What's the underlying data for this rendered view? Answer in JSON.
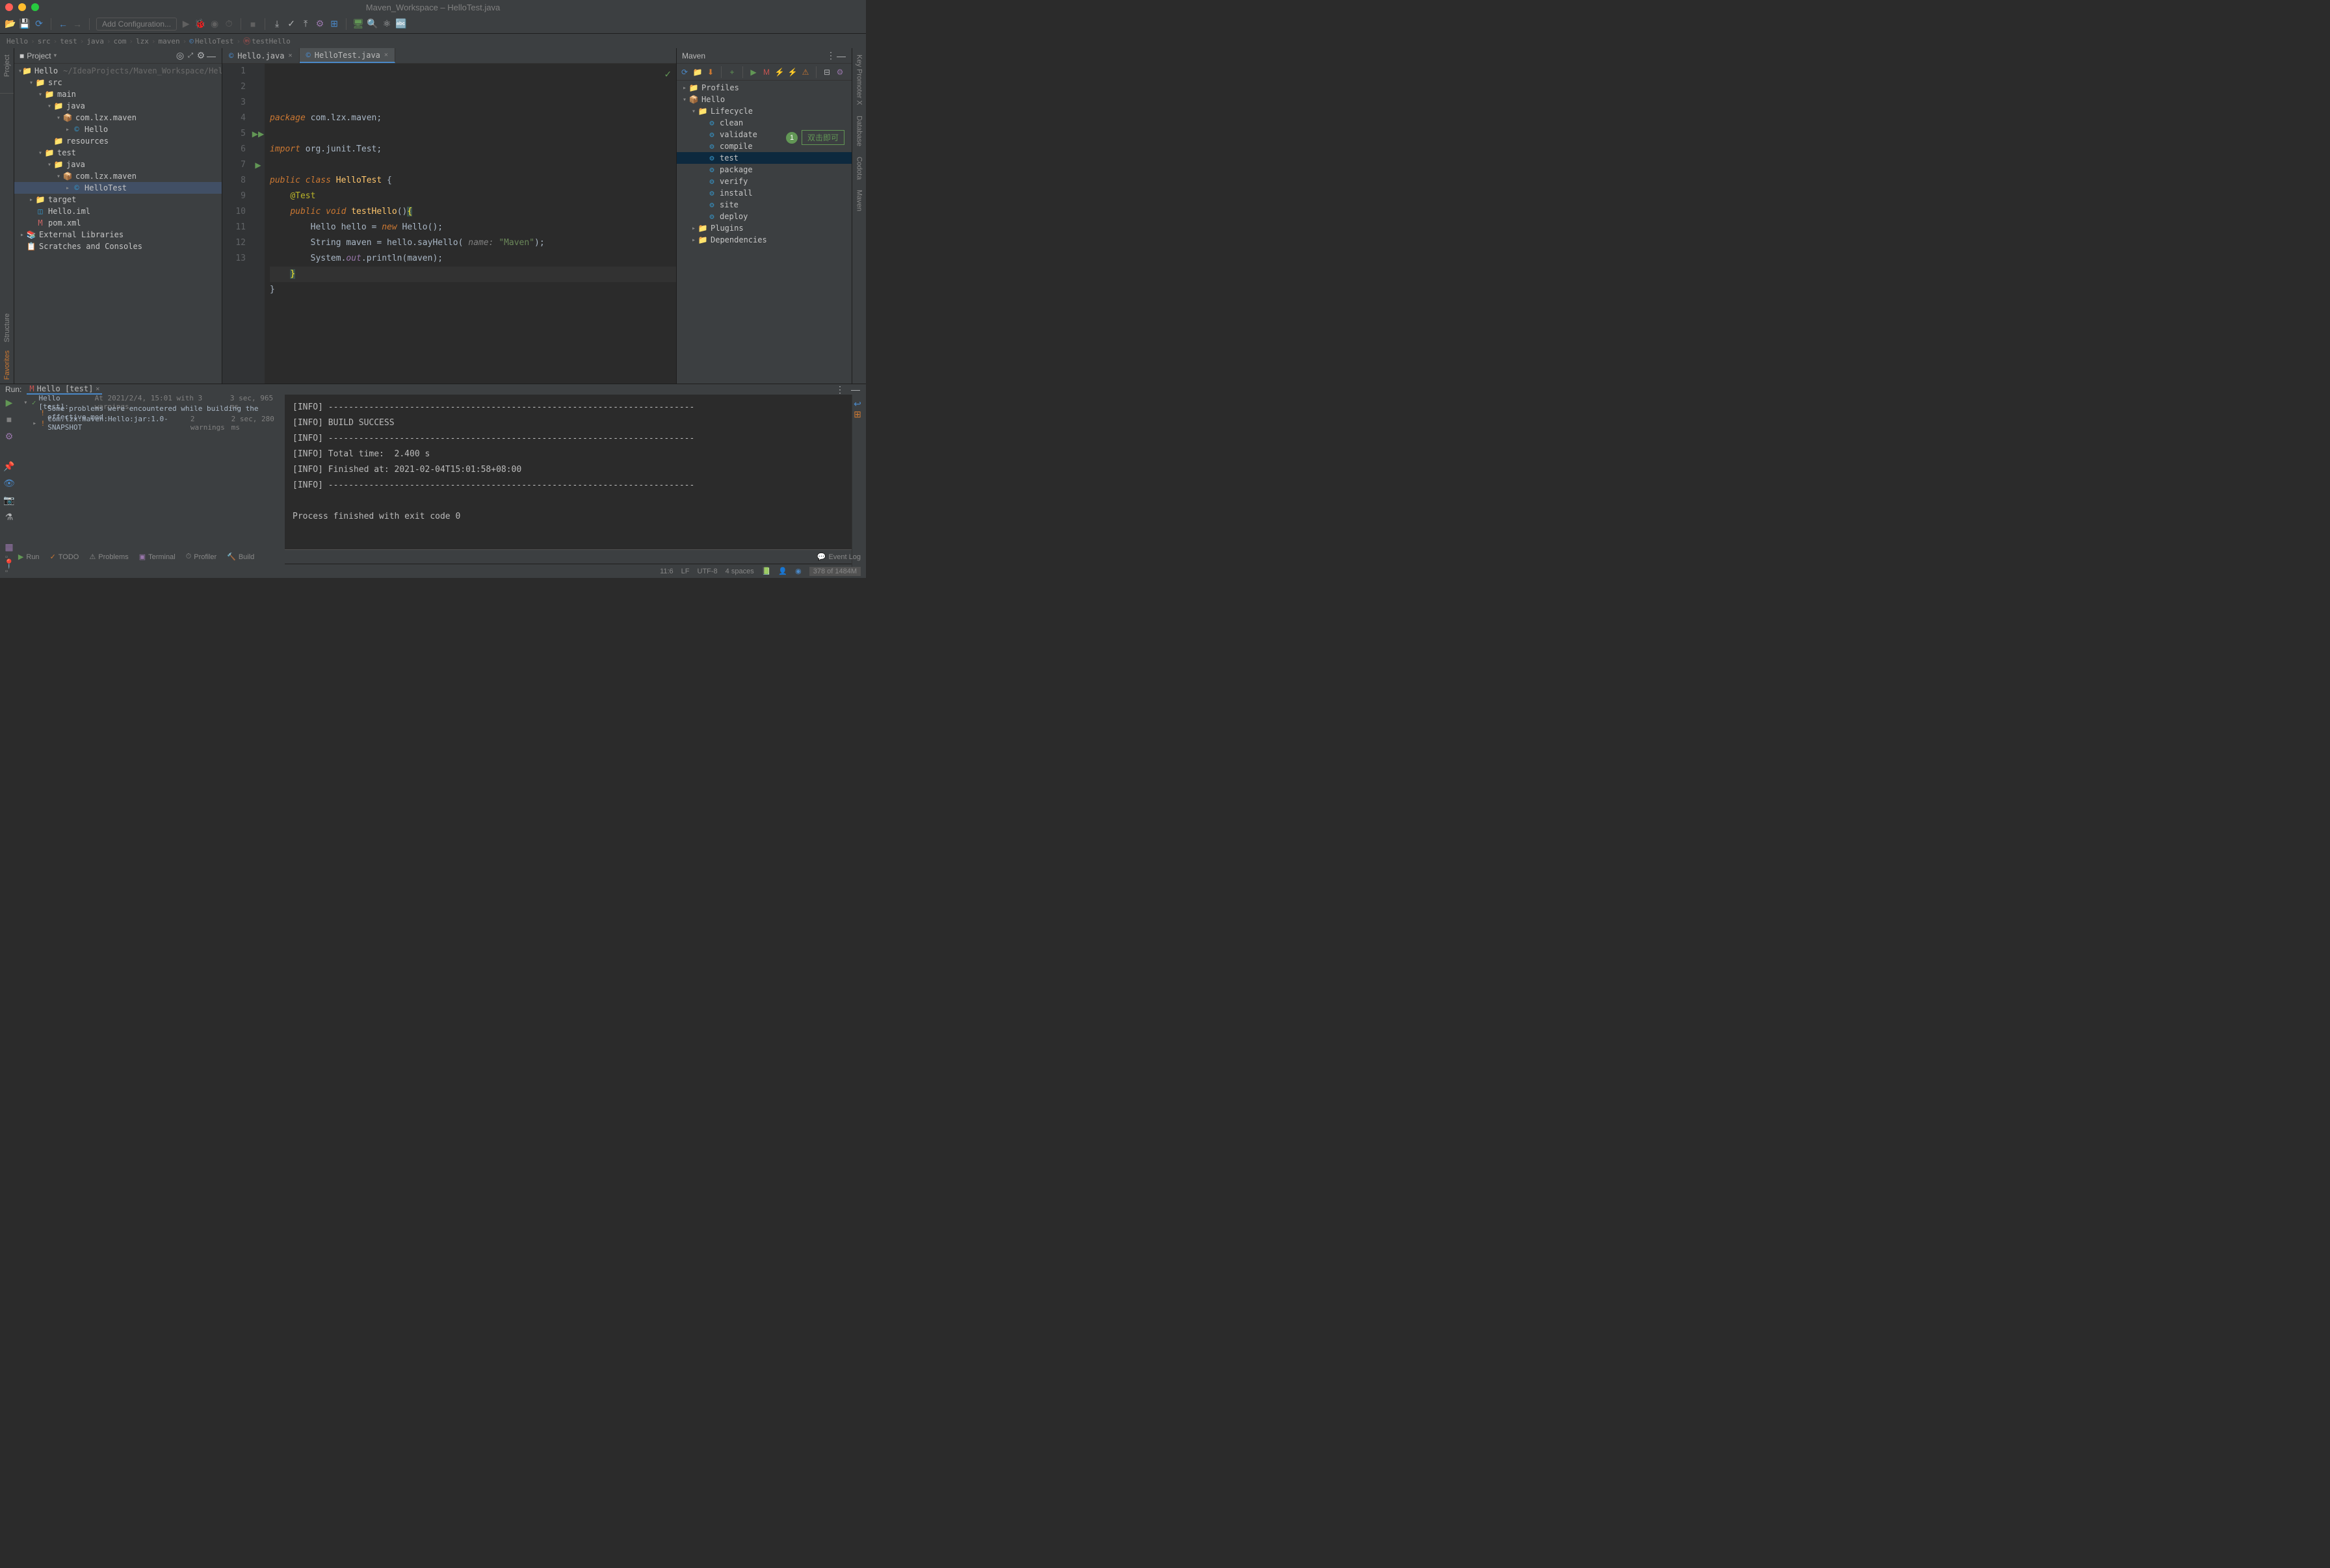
{
  "window": {
    "title": "Maven_Workspace – HelloTest.java"
  },
  "toolbar": {
    "config_placeholder": "Add Configuration..."
  },
  "breadcrumb": [
    "Hello",
    "src",
    "test",
    "java",
    "com",
    "lzx",
    "maven",
    "HelloTest",
    "testHello"
  ],
  "breadcrumb_icons": {
    "7": "©",
    "8": "m"
  },
  "project": {
    "header": "Project",
    "root": {
      "name": "Hello",
      "hint": "~/IdeaProjects/Maven_Workspace/Hello"
    },
    "tree": [
      {
        "d": 0,
        "exp": "v",
        "ico": "📁",
        "cls": "folder-red",
        "label": "Hello",
        "hint": "~/IdeaProjects/Maven_Workspace/Hello"
      },
      {
        "d": 1,
        "exp": "v",
        "ico": "📁",
        "cls": "folder-blue",
        "label": "src"
      },
      {
        "d": 2,
        "exp": "v",
        "ico": "📁",
        "cls": "folder-grey",
        "label": "main"
      },
      {
        "d": 3,
        "exp": "v",
        "ico": "📁",
        "cls": "folder-blue",
        "label": "java"
      },
      {
        "d": 4,
        "exp": "v",
        "ico": "📦",
        "cls": "folder-red",
        "label": "com.lzx.maven"
      },
      {
        "d": 5,
        "exp": ">",
        "ico": "©",
        "cls": "folder-blue",
        "label": "Hello"
      },
      {
        "d": 3,
        "exp": " ",
        "ico": "📁",
        "cls": "folder-purple",
        "label": "resources"
      },
      {
        "d": 2,
        "exp": "v",
        "ico": "📁",
        "cls": "folder-green",
        "label": "test"
      },
      {
        "d": 3,
        "exp": "v",
        "ico": "📁",
        "cls": "folder-green",
        "label": "java"
      },
      {
        "d": 4,
        "exp": "v",
        "ico": "📦",
        "cls": "folder-red",
        "label": "com.lzx.maven"
      },
      {
        "d": 5,
        "exp": ">",
        "ico": "©",
        "cls": "folder-blue",
        "label": "HelloTest",
        "sel": true
      },
      {
        "d": 1,
        "exp": ">",
        "ico": "📁",
        "cls": "folder-orange",
        "label": "target"
      },
      {
        "d": 1,
        "exp": " ",
        "ico": "◫",
        "cls": "folder-blue",
        "label": "Hello.iml"
      },
      {
        "d": 1,
        "exp": " ",
        "ico": "M",
        "cls": "folder-red",
        "label": "pom.xml"
      },
      {
        "d": 0,
        "exp": ">",
        "ico": "📚",
        "cls": "folder-orange",
        "label": "External Libraries"
      },
      {
        "d": 0,
        "exp": " ",
        "ico": "📋",
        "cls": "folder-orange",
        "label": "Scratches and Consoles"
      }
    ]
  },
  "editor": {
    "tabs": [
      {
        "label": "Hello.java",
        "active": false
      },
      {
        "label": "HelloTest.java",
        "active": true
      }
    ],
    "lines": {
      "1": {
        "html": "<span class='kw'>package</span> com.lzx.maven;"
      },
      "2": {
        "html": ""
      },
      "3": {
        "html": "<span class='kw'>import</span> org.junit.Test;"
      },
      "4": {
        "html": ""
      },
      "5": {
        "html": "<span class='kw'>public class</span> <span class='typ'>HelloTest</span> {",
        "gicon": "▶▶"
      },
      "6": {
        "html": "    <span class='ann'>@Test</span>"
      },
      "7": {
        "html": "    <span class='kw'>public void</span> <span class='fn'>testHello</span>()<span class='brace-hl'>{</span>",
        "gicon": "▶"
      },
      "8": {
        "html": "        Hello hello = <span class='kw'>new</span> Hello();"
      },
      "9": {
        "html": "        String maven = hello.sayHello( <span class='parm'>name:</span> <span class='str'>\"Maven\"</span>);"
      },
      "10": {
        "html": "        System.<span style='color:#9876aa;font-style:italic'>out</span>.println(maven);"
      },
      "11": {
        "html": "    <span class='brace-hl'>}</span>",
        "cur": true
      },
      "12": {
        "html": "}"
      },
      "13": {
        "html": ""
      }
    }
  },
  "maven": {
    "header": "Maven",
    "tree": [
      {
        "d": 0,
        "exp": ">",
        "ico": "📁",
        "cls": "folder-blue",
        "label": "Profiles"
      },
      {
        "d": 0,
        "exp": "v",
        "ico": "📦",
        "cls": "folder-red",
        "label": "Hello"
      },
      {
        "d": 1,
        "exp": "v",
        "ico": "📁",
        "cls": "folder-blue",
        "label": "Lifecycle"
      },
      {
        "d": 2,
        "exp": " ",
        "ico": "⚙",
        "cls": "folder-blue",
        "label": "clean"
      },
      {
        "d": 2,
        "exp": " ",
        "ico": "⚙",
        "cls": "folder-blue",
        "label": "validate"
      },
      {
        "d": 2,
        "exp": " ",
        "ico": "⚙",
        "cls": "folder-blue",
        "label": "compile"
      },
      {
        "d": 2,
        "exp": " ",
        "ico": "⚙",
        "cls": "folder-blue",
        "label": "test",
        "sel": true
      },
      {
        "d": 2,
        "exp": " ",
        "ico": "⚙",
        "cls": "folder-blue",
        "label": "package"
      },
      {
        "d": 2,
        "exp": " ",
        "ico": "⚙",
        "cls": "folder-blue",
        "label": "verify"
      },
      {
        "d": 2,
        "exp": " ",
        "ico": "⚙",
        "cls": "folder-blue",
        "label": "install"
      },
      {
        "d": 2,
        "exp": " ",
        "ico": "⚙",
        "cls": "folder-blue",
        "label": "site"
      },
      {
        "d": 2,
        "exp": " ",
        "ico": "⚙",
        "cls": "folder-blue",
        "label": "deploy"
      },
      {
        "d": 1,
        "exp": ">",
        "ico": "📁",
        "cls": "folder-blue",
        "label": "Plugins"
      },
      {
        "d": 1,
        "exp": ">",
        "ico": "📁",
        "cls": "folder-blue",
        "label": "Dependencies"
      }
    ],
    "callout": {
      "num": "1",
      "text": "双击即可"
    }
  },
  "run": {
    "label": "Run:",
    "tab": "Hello [test]",
    "tree": [
      {
        "d": 0,
        "exp": "v",
        "ico": "✓",
        "label": "Hello [test]:",
        "hint": "At 2021/2/4, 15:01 with 3 warnings",
        "time": "3 sec, 965 ms"
      },
      {
        "d": 1,
        "exp": " ",
        "ico": "!",
        "label": "Some problems were encountered while building the effective mod"
      },
      {
        "d": 1,
        "exp": ">",
        "ico": "!",
        "label": "com.lzx.maven:Hello:jar:1.0-SNAPSHOT",
        "hint": "2 warnings",
        "time": "2 sec, 280 ms"
      }
    ],
    "console": [
      "[INFO] ------------------------------------------------------------------------",
      "[INFO] BUILD SUCCESS",
      "[INFO] ------------------------------------------------------------------------",
      "[INFO] Total time:  2.400 s",
      "[INFO] Finished at: 2021-02-04T15:01:58+08:00",
      "[INFO] ------------------------------------------------------------------------",
      "",
      "Process finished with exit code 0"
    ]
  },
  "toolwindows": {
    "left_top": [
      "Project",
      "Structure",
      "Favorites"
    ],
    "right_top": [
      "Key Promoter X",
      "Database",
      "Codota",
      "Maven"
    ],
    "bottom": [
      "Run",
      "TODO",
      "Problems",
      "Terminal",
      "Profiler",
      "Build"
    ],
    "event_log": "Event Log"
  },
  "statusbar": {
    "pos": "11:6",
    "le": "LF",
    "enc": "UTF-8",
    "indent": "4 spaces",
    "mem": "378 of 1484M"
  }
}
